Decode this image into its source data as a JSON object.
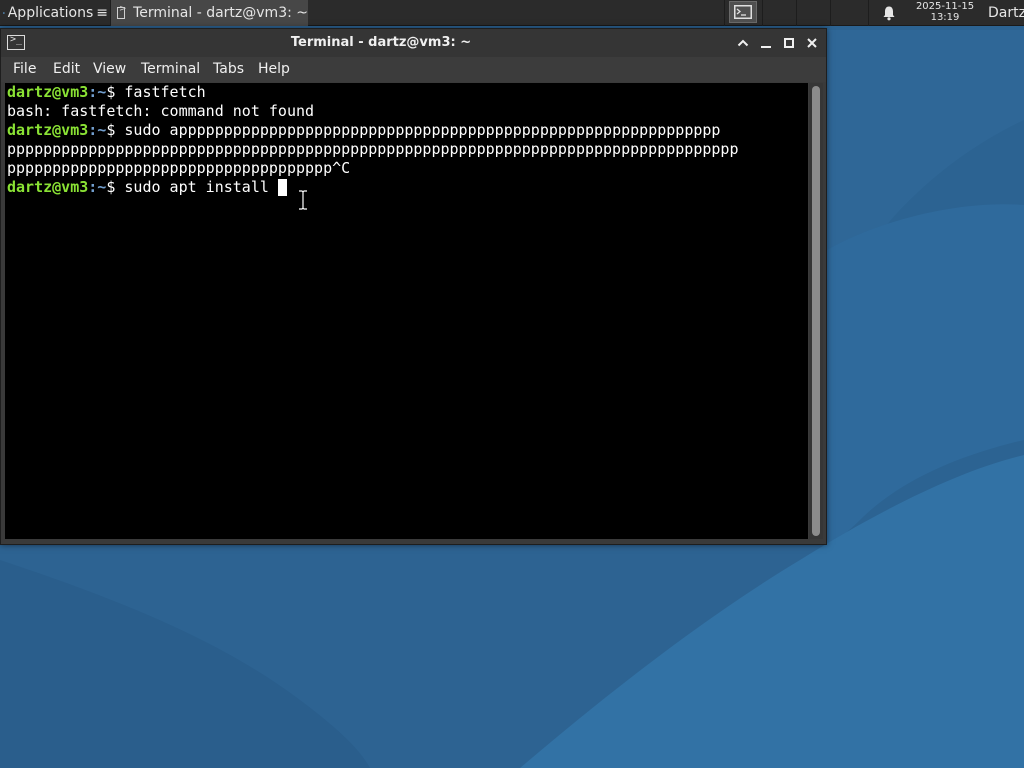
{
  "panel": {
    "applications_label": "Applications",
    "taskbar_window_title": "Terminal - dartz@vm3: ~",
    "clock_date": "2025-11-15",
    "clock_time": "13:19",
    "user_name": "Dartz"
  },
  "window": {
    "title": "Terminal - dartz@vm3: ~",
    "menu": [
      "File",
      "Edit",
      "View",
      "Terminal",
      "Tabs",
      "Help"
    ]
  },
  "terminal": {
    "prompt_user": "dartz@vm3",
    "prompt_path": ":~",
    "prompt_symbol": "$",
    "lines": [
      {
        "type": "prompt",
        "command": " fastfetch"
      },
      {
        "type": "output",
        "text": "bash: fastfetch: command not found"
      },
      {
        "type": "prompt",
        "command": " sudo apppppppppppppppppppppppppppppppppppppppppppppppppppppppppppp"
      },
      {
        "type": "output",
        "text": "ppppppppppppppppppppppppppppppppppppppppppppppppppppppppppppppppppppppppppppppppp"
      },
      {
        "type": "output",
        "text": "pppppppppppppppppppppppppppppppppppp^C"
      },
      {
        "type": "prompt",
        "command": " sudo apt install "
      }
    ]
  },
  "colors": {
    "prompt_user": "#8ae234",
    "prompt_path": "#729fcf",
    "terminal_bg": "#000000",
    "wallpaper": "#2d6190"
  },
  "icons": {
    "applications": "xfce-mouse-icon",
    "taskbar_terminal": "terminal-icon",
    "notifications": "bell-icon",
    "window_menu": "terminal-icon",
    "minimize": "minimize-icon",
    "maximize": "maximize-icon",
    "close": "close-icon"
  }
}
